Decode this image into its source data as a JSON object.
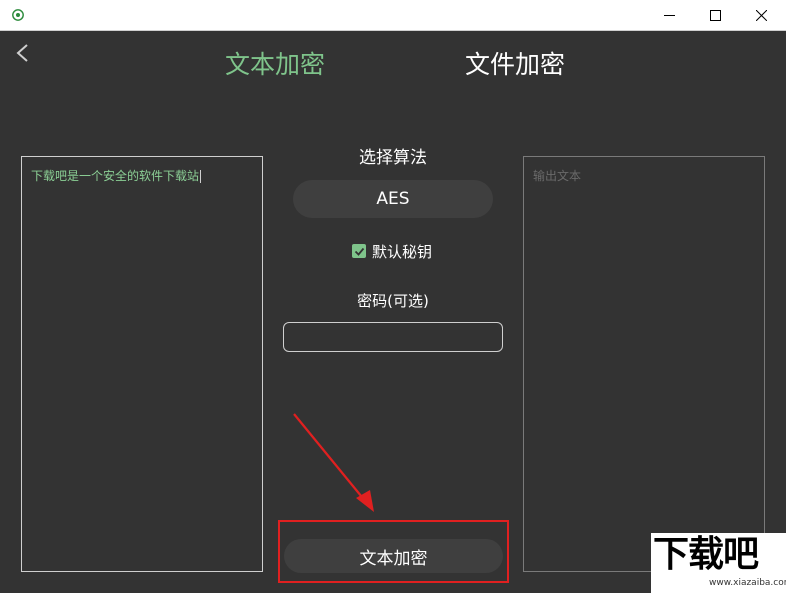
{
  "window": {
    "app_icon": "eye-app-icon",
    "controls": {
      "minimize": "minimize-icon",
      "maximize": "maximize-icon",
      "close": "close-icon"
    }
  },
  "header": {
    "back_icon": "chevron-left-icon",
    "tabs": [
      {
        "label": "文本加密",
        "active": true
      },
      {
        "label": "文件加密",
        "active": false
      }
    ]
  },
  "input_panel": {
    "value": "下载吧是一个安全的软件下载站"
  },
  "output_panel": {
    "placeholder": "输出文本"
  },
  "algorithm": {
    "label": "选择算法",
    "selected": "AES"
  },
  "default_key": {
    "label": "默认秘钥",
    "checked": true
  },
  "password": {
    "label": "密码(可选)",
    "value": ""
  },
  "actions": {
    "encrypt_label": "文本加密"
  },
  "watermark": {
    "logo": "下载吧",
    "url": "www.xiazaiba.com"
  },
  "colors": {
    "accent": "#7fc48b",
    "background": "#333333",
    "highlight": "#e02020"
  }
}
